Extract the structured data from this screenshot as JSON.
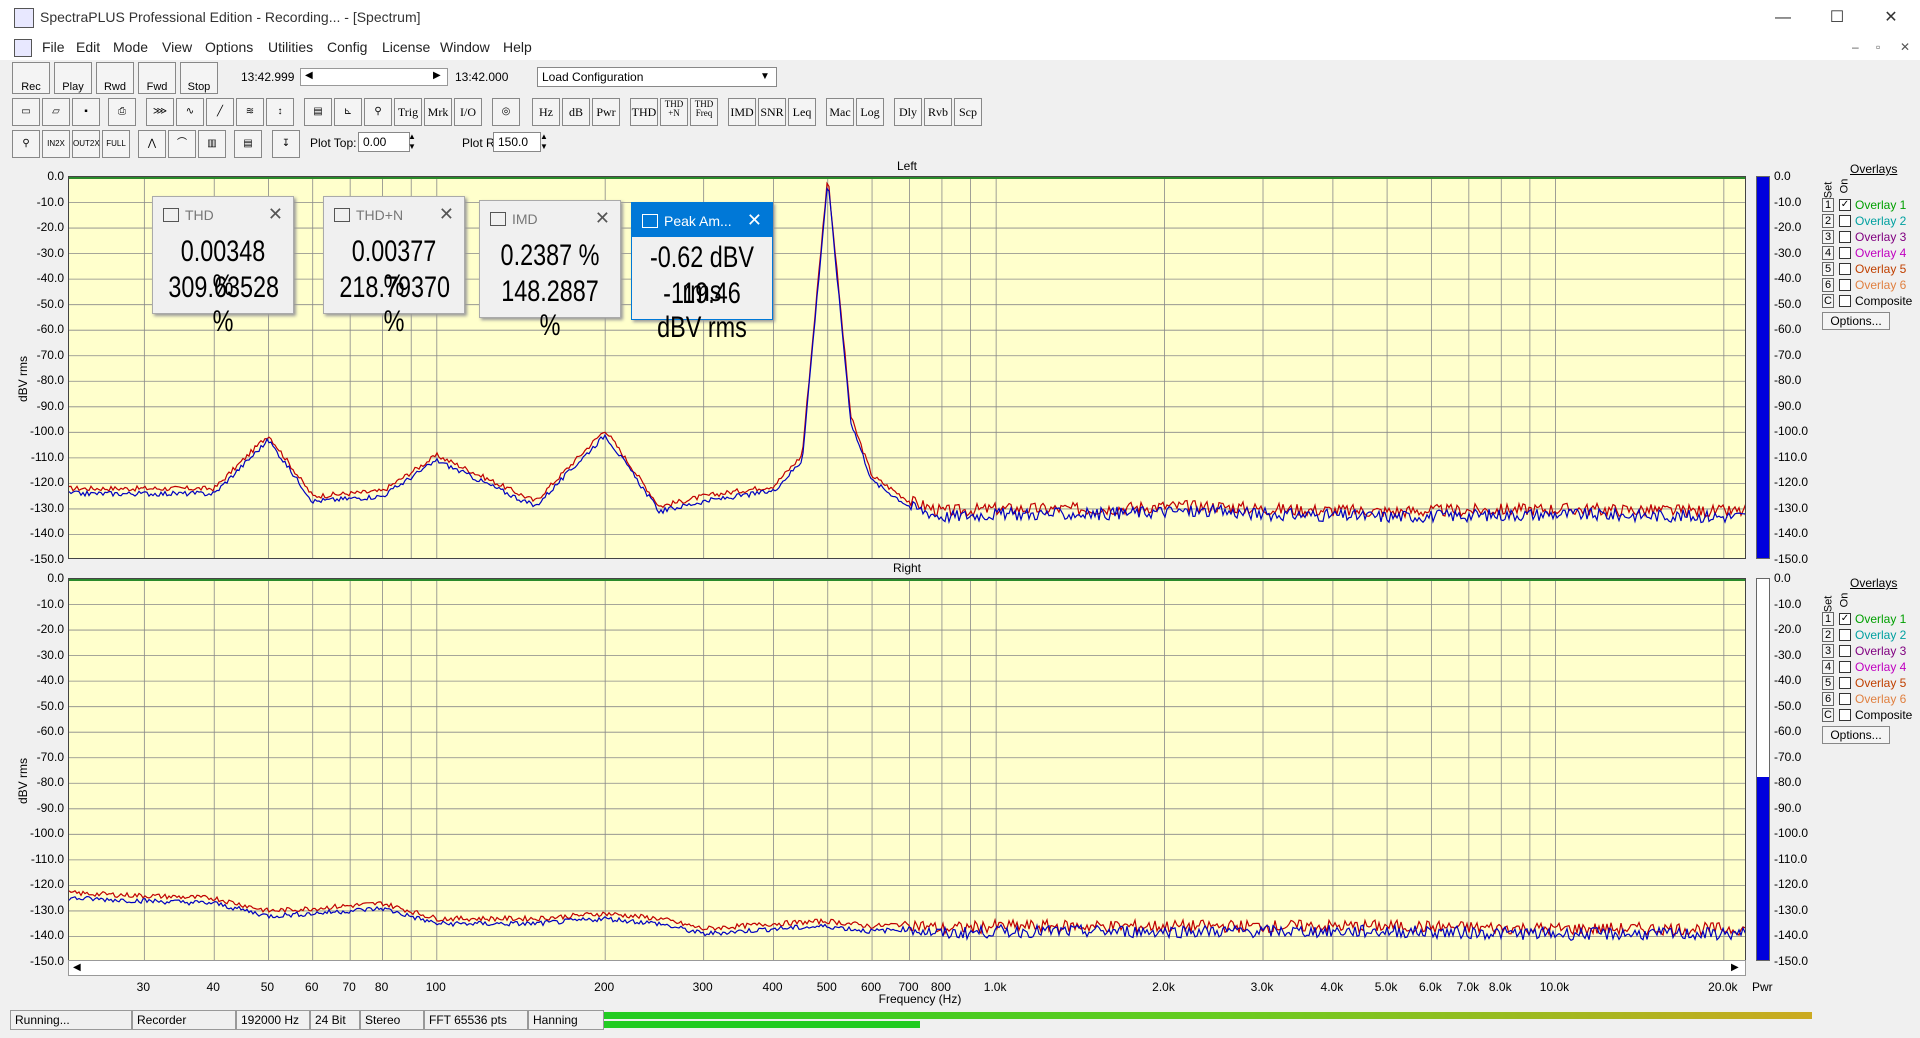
{
  "window": {
    "title": "SpectraPLUS Professional Edition - Recording... - [Spectrum]",
    "min": "—",
    "max": "☐",
    "close": "✕"
  },
  "menu": [
    "File",
    "Edit",
    "Mode",
    "View",
    "Options",
    "Utilities",
    "Config",
    "License",
    "Window",
    "Help"
  ],
  "transport": {
    "rec": "Rec",
    "play": "Play",
    "rwd": "Rwd",
    "fwd": "Fwd",
    "stop": "Stop",
    "time_start": "13:42.999",
    "time_end": "13:42.000",
    "config": "Load Configuration"
  },
  "toolbar2": [
    "Trig",
    "Mrk",
    "I/O",
    "Hz",
    "dB",
    "Pwr",
    "THD",
    "THD +N",
    "THD Freq",
    "IMD",
    "SNR",
    "Leq",
    "Mac",
    "Log",
    "Dly",
    "Rvb",
    "Scp"
  ],
  "toolbar3": {
    "plot_top_label": "Plot Top:",
    "plot_top": "0.00",
    "plot_range_label": "Plot Range:",
    "plot_range": "150.0"
  },
  "channels": {
    "left": "Left",
    "right": "Right"
  },
  "y_axis_title": "dBV rms",
  "y_ticks": [
    "0.0",
    "-10.0",
    "-20.0",
    "-30.0",
    "-40.0",
    "-50.0",
    "-60.0",
    "-70.0",
    "-80.0",
    "-90.0",
    "-100.0",
    "-110.0",
    "-120.0",
    "-130.0",
    "-140.0",
    "-150.0"
  ],
  "x_ticks": [
    "30",
    "40",
    "50",
    "60",
    "70",
    "80",
    "100",
    "200",
    "300",
    "400",
    "500",
    "600",
    "700",
    "800",
    "1.0k",
    "2.0k",
    "3.0k",
    "4.0k",
    "5.0k",
    "6.0k",
    "7.0k",
    "8.0k",
    "10.0k",
    "20.0k"
  ],
  "x_axis_title": "Frequency (Hz)",
  "pwr_label": "Pwr",
  "overlays": {
    "title": "Overlays",
    "set_label": "Set",
    "on_label": "On",
    "items": [
      {
        "num": "1",
        "name": "Overlay 1",
        "checked": true,
        "color": "#00a000"
      },
      {
        "num": "2",
        "name": "Overlay 2",
        "checked": false,
        "color": "#00a0a0"
      },
      {
        "num": "3",
        "name": "Overlay 3",
        "checked": false,
        "color": "#800080"
      },
      {
        "num": "4",
        "name": "Overlay 4",
        "checked": false,
        "color": "#c000c0"
      },
      {
        "num": "5",
        "name": "Overlay 5",
        "checked": false,
        "color": "#c04000"
      },
      {
        "num": "6",
        "name": "Overlay 6",
        "checked": false,
        "color": "#e08040"
      },
      {
        "num": "C",
        "name": "Composite",
        "checked": false,
        "color": "#000000"
      }
    ],
    "options": "Options..."
  },
  "popups": [
    {
      "title": "THD",
      "v1": "0.00348 %",
      "v2": "309.63528 %",
      "active": false
    },
    {
      "title": "THD+N",
      "v1": "0.00377 %",
      "v2": "218.79370 %",
      "active": false
    },
    {
      "title": "IMD",
      "v1": "0.2387 %",
      "v2": "148.2887 %",
      "active": false
    },
    {
      "title": "Peak Am...",
      "v1": "-0.62 dBV rms",
      "v2": "-119.46 dBV rms",
      "active": true
    }
  ],
  "status": {
    "state": "Running...",
    "mode": "Recorder",
    "rate": "192000 Hz",
    "bits": "24 Bit",
    "chan": "Stereo",
    "fft": "FFT 65536 pts",
    "window": "Hanning"
  },
  "meters": {
    "left_level": 1.0,
    "right_level": 0.48
  },
  "colors": {
    "plot_bg": "#ffffcc",
    "trace_blue": "#0000c0",
    "trace_red": "#c00000",
    "meter": "#0000dd"
  },
  "chart_data": {
    "type": "line",
    "xlabel": "Frequency (Hz)",
    "ylabel": "dBV rms",
    "xscale": "log",
    "xlim": [
      22,
      22000
    ],
    "ylim": [
      -150,
      0
    ],
    "series": [
      {
        "channel": "Left",
        "x": [
          22,
          40,
          50,
          60,
          80,
          100,
          150,
          200,
          250,
          300,
          400,
          450,
          500,
          550,
          600,
          700,
          800,
          1000,
          1500,
          2000,
          2500,
          3000,
          5000,
          10000,
          20000
        ],
        "values": [
          -123,
          -123,
          -102,
          -126,
          -124,
          -110,
          -128,
          -100,
          -130,
          -126,
          -122,
          -110,
          0,
          -95,
          -118,
          -128,
          -132,
          -131,
          -131,
          -130,
          -130,
          -131,
          -132,
          -131,
          -132
        ]
      },
      {
        "channel": "Right",
        "x": [
          22,
          40,
          50,
          60,
          80,
          100,
          150,
          200,
          250,
          300,
          400,
          500,
          600,
          700,
          800,
          1000,
          2000,
          5000,
          10000,
          20000
        ],
        "values": [
          -124,
          -126,
          -131,
          -130,
          -128,
          -134,
          -134,
          -132,
          -134,
          -138,
          -136,
          -135,
          -137,
          -136,
          -138,
          -137,
          -137,
          -137,
          -138,
          -138
        ]
      }
    ]
  }
}
